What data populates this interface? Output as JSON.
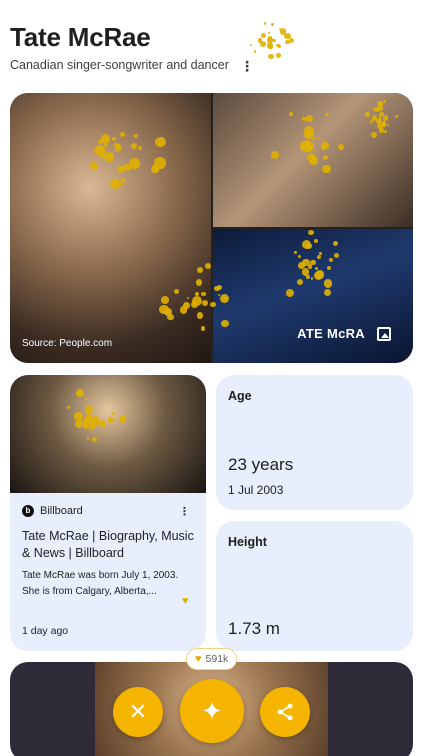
{
  "entity": {
    "name": "Tate McRae",
    "description": "Canadian singer-songwriter and dancer"
  },
  "gallery": {
    "source_label": "Source: People.com",
    "overlay_text": "ATE McRA"
  },
  "news": {
    "publisher": "Billboard",
    "publisher_initial": "b",
    "title": "Tate McRae | Biography, Music & News | Billboard",
    "snippet": "Tate McRae was born July 1, 2003. She is from Calgary, Alberta,...",
    "time": "1 day ago"
  },
  "facts": {
    "age": {
      "label": "Age",
      "value": "23 years",
      "sub": "1 Jul 2003"
    },
    "height": {
      "label": "Height",
      "value": "1.73 m"
    }
  },
  "reactions": {
    "likes": "591k"
  },
  "actions": {
    "close_icon": "close-icon",
    "sparkle_icon": "sparkle-icon",
    "share_icon": "share-icon"
  },
  "colors": {
    "accent": "#f4b400",
    "card_bg": "#e8eefc",
    "splatter": "#e0b000"
  }
}
